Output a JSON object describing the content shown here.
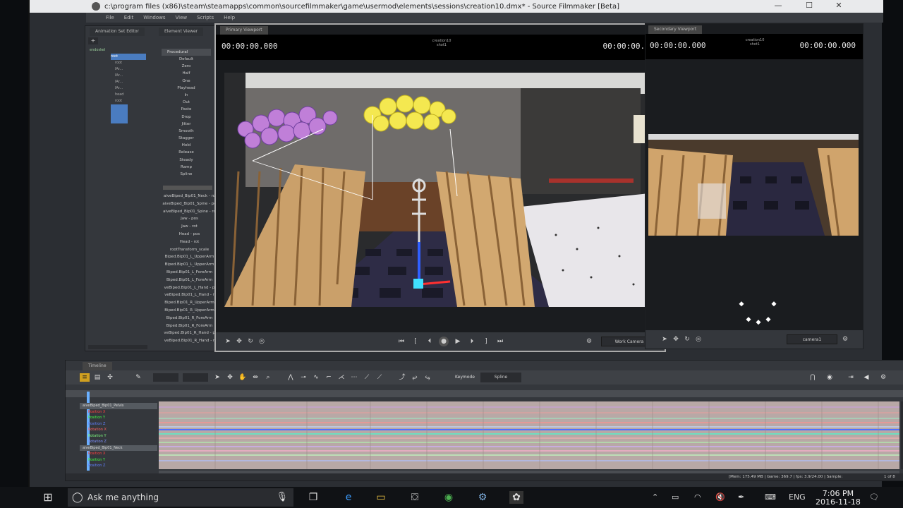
{
  "window": {
    "title": "c:\\program files (x86)\\steam\\steamapps\\common\\sourcefilmmaker\\game\\usermod\\elements\\sessions\\creation10.dmx* - Source Filmmaker [Beta]",
    "minimize": "—",
    "maximize": "☐",
    "close": "✕"
  },
  "menu": [
    "File",
    "Edit",
    "Windows",
    "View",
    "Scripts",
    "Help"
  ],
  "left_panel": {
    "tabs": [
      "Animation Set Editor",
      "Element Viewer"
    ],
    "add_label": "+",
    "procedural_header": "Procedural",
    "procedural_items": [
      "Default",
      "Zero",
      "Half",
      "One",
      "Playhead",
      "In",
      "Out",
      "Paste",
      "Drop",
      "Jitter",
      "Smooth",
      "Stagger",
      "Hold",
      "Release",
      "Steady",
      "Ramp",
      "Spline"
    ],
    "tree_items": [
      "endoskel",
      "root",
      "root",
      "lAr...",
      "lAr...",
      "lAr...",
      "lAr...",
      "head",
      "root"
    ],
    "controls": [
      "aiveBiped_Bip01_Neck - ro",
      "aiveBiped_Bip01_Spine - po",
      "aiveBiped_Bip01_Spine - ro",
      "Jaw - pos",
      "Jaw - rot",
      "Head - pos",
      "Head - rot",
      "rootTransform_scale",
      "Biped.Bip01_L_UpperArm",
      "Biped.Bip01_L_UpperArm",
      "Biped.Bip01_L_ForeArm",
      "Biped.Bip01_L_ForeArm",
      "veBiped.Bip01_L_Hand - p",
      "veBiped.Bip01_L_Hand - r",
      "Biped.Bip01_R_UpperArm",
      "Biped.Bip01_R_UpperArm",
      "Biped.Bip01_R_ForeArm",
      "Biped.Bip01_R_ForeArm",
      "veBiped.Bip01_R_Hand - p",
      "veBiped.Bip01_R_Hand - r"
    ]
  },
  "primary_viewport": {
    "tab": "Primary Viewport",
    "timecode_left": "00:00:00.000",
    "timecode_right": "00:00:00.000",
    "clip": "creation10",
    "shot": "shot1",
    "camera": "Work Camera"
  },
  "secondary_viewport": {
    "tab": "Secondary Viewport",
    "timecode_left": "00:00:00.000",
    "timecode_right": "00:00:00.000",
    "clip": "creation10",
    "shot": "shot1",
    "camera": "camera1"
  },
  "timeline": {
    "tab": "Timeline",
    "keymode_label": "Keymode",
    "keymode_value": "Spline",
    "channel_groups": [
      {
        "name": "aiveBiped_Bip01_Pelvis",
        "channels": [
          "Position X",
          "Position Y",
          "Position Z",
          "Rotation X",
          "Rotation Y",
          "Rotation Z"
        ]
      },
      {
        "name": "aiveBiped_Bip01_Neck",
        "channels": [
          "Position X",
          "Position Y",
          "Position Z"
        ]
      }
    ],
    "status_mem": "[Mem:    175.49 MB | Game:     369.7 | fps:    3.9/24.00 | Sample:",
    "status_page": "1 of 8"
  },
  "colors": {
    "pos_x": "#ff4040",
    "pos_y": "#40ff40",
    "pos_z": "#6080ff",
    "rot_x": "#ff6060",
    "rot_y": "#80ff80",
    "rot_z": "#8090ff"
  },
  "taskbar": {
    "search_placeholder": "Ask me anything",
    "language": "ENG",
    "time": "7:06 PM",
    "date": "2016-11-18"
  }
}
